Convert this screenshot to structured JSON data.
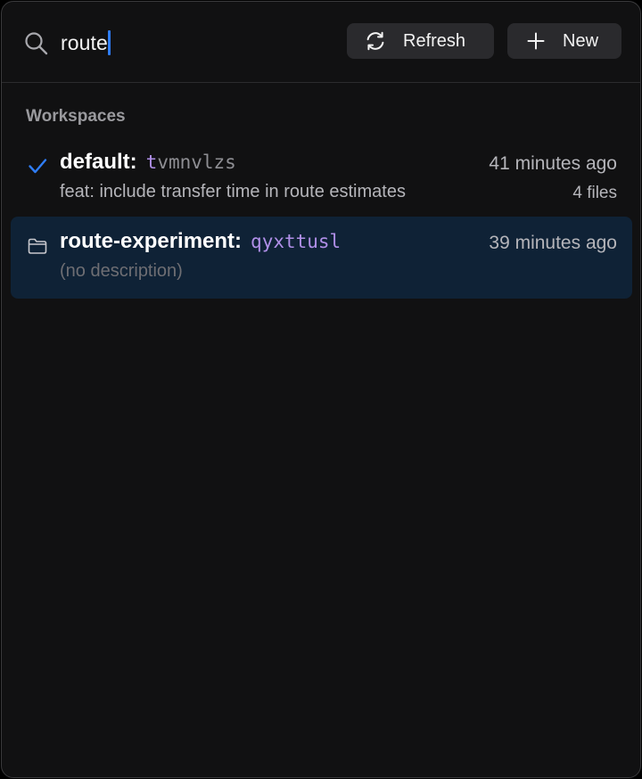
{
  "search": {
    "query": "route"
  },
  "toolbar": {
    "refresh_label": "Refresh",
    "new_label": "New"
  },
  "section": {
    "title": "Workspaces"
  },
  "workspaces": [
    {
      "name": "default:",
      "id_prefix": "t",
      "id_rest": "vmnvlzs",
      "time": "41 minutes ago",
      "description": "feat: include transfer time in route estimates",
      "files": "4 files",
      "icon": "checkmark-icon",
      "current": true
    },
    {
      "name": "route-experiment:",
      "id_prefix": "qyxttusl",
      "id_rest": "",
      "time": "39 minutes ago",
      "description": "(no description)",
      "icon": "folder-icon",
      "selected": true
    }
  ],
  "colors": {
    "accent": "#2f7df6",
    "id_highlight": "#b08fe8",
    "selected_row": "#0f2236"
  }
}
